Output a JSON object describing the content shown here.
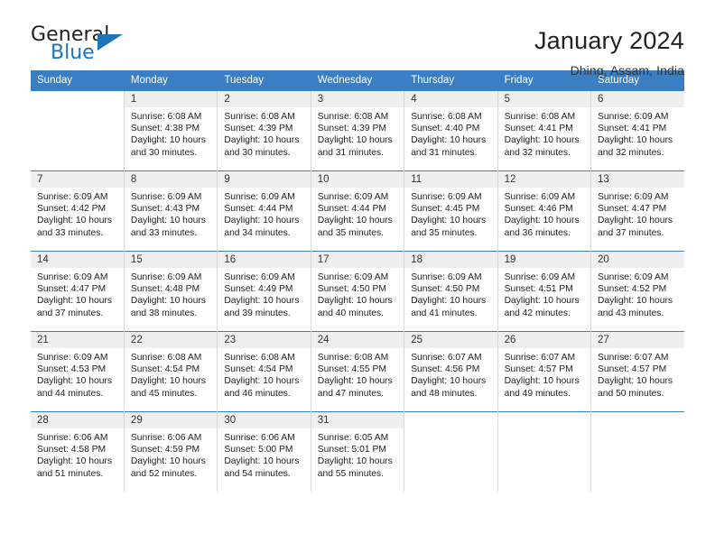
{
  "brand": {
    "name_part1": "General",
    "name_part2": "Blue",
    "accent_color": "#1b75bb"
  },
  "header": {
    "title": "January 2024",
    "location": "Dhing, Assam, India",
    "header_bg_color": "#3a7ec4"
  },
  "weekdays": [
    "Sunday",
    "Monday",
    "Tuesday",
    "Wednesday",
    "Thursday",
    "Friday",
    "Saturday"
  ],
  "weeks": [
    [
      {
        "day": "",
        "sunrise": "",
        "sunset": "",
        "daylight1": "",
        "daylight2": ""
      },
      {
        "day": "1",
        "sunrise": "Sunrise: 6:08 AM",
        "sunset": "Sunset: 4:38 PM",
        "daylight1": "Daylight: 10 hours",
        "daylight2": "and 30 minutes."
      },
      {
        "day": "2",
        "sunrise": "Sunrise: 6:08 AM",
        "sunset": "Sunset: 4:39 PM",
        "daylight1": "Daylight: 10 hours",
        "daylight2": "and 30 minutes."
      },
      {
        "day": "3",
        "sunrise": "Sunrise: 6:08 AM",
        "sunset": "Sunset: 4:39 PM",
        "daylight1": "Daylight: 10 hours",
        "daylight2": "and 31 minutes."
      },
      {
        "day": "4",
        "sunrise": "Sunrise: 6:08 AM",
        "sunset": "Sunset: 4:40 PM",
        "daylight1": "Daylight: 10 hours",
        "daylight2": "and 31 minutes."
      },
      {
        "day": "5",
        "sunrise": "Sunrise: 6:08 AM",
        "sunset": "Sunset: 4:41 PM",
        "daylight1": "Daylight: 10 hours",
        "daylight2": "and 32 minutes."
      },
      {
        "day": "6",
        "sunrise": "Sunrise: 6:09 AM",
        "sunset": "Sunset: 4:41 PM",
        "daylight1": "Daylight: 10 hours",
        "daylight2": "and 32 minutes."
      }
    ],
    [
      {
        "day": "7",
        "sunrise": "Sunrise: 6:09 AM",
        "sunset": "Sunset: 4:42 PM",
        "daylight1": "Daylight: 10 hours",
        "daylight2": "and 33 minutes."
      },
      {
        "day": "8",
        "sunrise": "Sunrise: 6:09 AM",
        "sunset": "Sunset: 4:43 PM",
        "daylight1": "Daylight: 10 hours",
        "daylight2": "and 33 minutes."
      },
      {
        "day": "9",
        "sunrise": "Sunrise: 6:09 AM",
        "sunset": "Sunset: 4:44 PM",
        "daylight1": "Daylight: 10 hours",
        "daylight2": "and 34 minutes."
      },
      {
        "day": "10",
        "sunrise": "Sunrise: 6:09 AM",
        "sunset": "Sunset: 4:44 PM",
        "daylight1": "Daylight: 10 hours",
        "daylight2": "and 35 minutes."
      },
      {
        "day": "11",
        "sunrise": "Sunrise: 6:09 AM",
        "sunset": "Sunset: 4:45 PM",
        "daylight1": "Daylight: 10 hours",
        "daylight2": "and 35 minutes."
      },
      {
        "day": "12",
        "sunrise": "Sunrise: 6:09 AM",
        "sunset": "Sunset: 4:46 PM",
        "daylight1": "Daylight: 10 hours",
        "daylight2": "and 36 minutes."
      },
      {
        "day": "13",
        "sunrise": "Sunrise: 6:09 AM",
        "sunset": "Sunset: 4:47 PM",
        "daylight1": "Daylight: 10 hours",
        "daylight2": "and 37 minutes."
      }
    ],
    [
      {
        "day": "14",
        "sunrise": "Sunrise: 6:09 AM",
        "sunset": "Sunset: 4:47 PM",
        "daylight1": "Daylight: 10 hours",
        "daylight2": "and 37 minutes."
      },
      {
        "day": "15",
        "sunrise": "Sunrise: 6:09 AM",
        "sunset": "Sunset: 4:48 PM",
        "daylight1": "Daylight: 10 hours",
        "daylight2": "and 38 minutes."
      },
      {
        "day": "16",
        "sunrise": "Sunrise: 6:09 AM",
        "sunset": "Sunset: 4:49 PM",
        "daylight1": "Daylight: 10 hours",
        "daylight2": "and 39 minutes."
      },
      {
        "day": "17",
        "sunrise": "Sunrise: 6:09 AM",
        "sunset": "Sunset: 4:50 PM",
        "daylight1": "Daylight: 10 hours",
        "daylight2": "and 40 minutes."
      },
      {
        "day": "18",
        "sunrise": "Sunrise: 6:09 AM",
        "sunset": "Sunset: 4:50 PM",
        "daylight1": "Daylight: 10 hours",
        "daylight2": "and 41 minutes."
      },
      {
        "day": "19",
        "sunrise": "Sunrise: 6:09 AM",
        "sunset": "Sunset: 4:51 PM",
        "daylight1": "Daylight: 10 hours",
        "daylight2": "and 42 minutes."
      },
      {
        "day": "20",
        "sunrise": "Sunrise: 6:09 AM",
        "sunset": "Sunset: 4:52 PM",
        "daylight1": "Daylight: 10 hours",
        "daylight2": "and 43 minutes."
      }
    ],
    [
      {
        "day": "21",
        "sunrise": "Sunrise: 6:09 AM",
        "sunset": "Sunset: 4:53 PM",
        "daylight1": "Daylight: 10 hours",
        "daylight2": "and 44 minutes."
      },
      {
        "day": "22",
        "sunrise": "Sunrise: 6:08 AM",
        "sunset": "Sunset: 4:54 PM",
        "daylight1": "Daylight: 10 hours",
        "daylight2": "and 45 minutes."
      },
      {
        "day": "23",
        "sunrise": "Sunrise: 6:08 AM",
        "sunset": "Sunset: 4:54 PM",
        "daylight1": "Daylight: 10 hours",
        "daylight2": "and 46 minutes."
      },
      {
        "day": "24",
        "sunrise": "Sunrise: 6:08 AM",
        "sunset": "Sunset: 4:55 PM",
        "daylight1": "Daylight: 10 hours",
        "daylight2": "and 47 minutes."
      },
      {
        "day": "25",
        "sunrise": "Sunrise: 6:07 AM",
        "sunset": "Sunset: 4:56 PM",
        "daylight1": "Daylight: 10 hours",
        "daylight2": "and 48 minutes."
      },
      {
        "day": "26",
        "sunrise": "Sunrise: 6:07 AM",
        "sunset": "Sunset: 4:57 PM",
        "daylight1": "Daylight: 10 hours",
        "daylight2": "and 49 minutes."
      },
      {
        "day": "27",
        "sunrise": "Sunrise: 6:07 AM",
        "sunset": "Sunset: 4:57 PM",
        "daylight1": "Daylight: 10 hours",
        "daylight2": "and 50 minutes."
      }
    ],
    [
      {
        "day": "28",
        "sunrise": "Sunrise: 6:06 AM",
        "sunset": "Sunset: 4:58 PM",
        "daylight1": "Daylight: 10 hours",
        "daylight2": "and 51 minutes."
      },
      {
        "day": "29",
        "sunrise": "Sunrise: 6:06 AM",
        "sunset": "Sunset: 4:59 PM",
        "daylight1": "Daylight: 10 hours",
        "daylight2": "and 52 minutes."
      },
      {
        "day": "30",
        "sunrise": "Sunrise: 6:06 AM",
        "sunset": "Sunset: 5:00 PM",
        "daylight1": "Daylight: 10 hours",
        "daylight2": "and 54 minutes."
      },
      {
        "day": "31",
        "sunrise": "Sunrise: 6:05 AM",
        "sunset": "Sunset: 5:01 PM",
        "daylight1": "Daylight: 10 hours",
        "daylight2": "and 55 minutes."
      },
      {
        "day": "",
        "sunrise": "",
        "sunset": "",
        "daylight1": "",
        "daylight2": ""
      },
      {
        "day": "",
        "sunrise": "",
        "sunset": "",
        "daylight1": "",
        "daylight2": ""
      },
      {
        "day": "",
        "sunrise": "",
        "sunset": "",
        "daylight1": "",
        "daylight2": ""
      }
    ]
  ]
}
